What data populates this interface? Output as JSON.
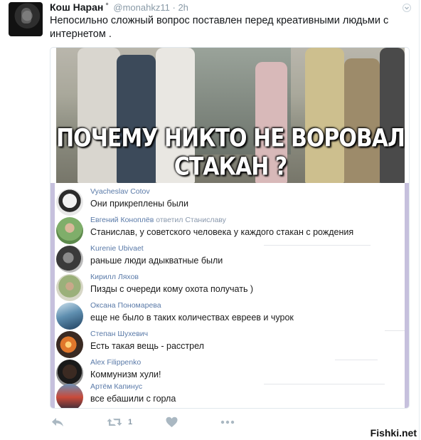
{
  "tweet": {
    "author_name": "Кош Наран",
    "verified_glyph": "°",
    "handle": "@monahkz11",
    "separator": "·",
    "time": "2h",
    "text": "Непосильно сложный вопрос поставлен перед креативными людьми с интернетом .",
    "retweet_count": "1"
  },
  "image": {
    "caption_line1": "ПОЧЕМУ НИКТО НЕ ВОРОВАЛ",
    "caption_line2": "СТАКАН ?"
  },
  "comments": [
    {
      "author": "Vyacheslav Cotov",
      "reply_label": "",
      "reply_to": "",
      "text": "Они прикреплены были"
    },
    {
      "author": "Евгений Коноплёв",
      "reply_label": "ответил",
      "reply_to": "Станиславу",
      "text": "Станислав, у советского человека у каждого стакан с рождения"
    },
    {
      "author": "Kurenie Ubivaet",
      "reply_label": "",
      "reply_to": "",
      "text": "раньше люди адыкватные были"
    },
    {
      "author": "Кирилл Ляхов",
      "reply_label": "",
      "reply_to": "",
      "text": "Пизды с очереди кому охота получать )"
    },
    {
      "author": "Оксана Пономарева",
      "reply_label": "",
      "reply_to": "",
      "text": "еще не было в таких количествах евреев и чурок"
    },
    {
      "author": "Степан Шухевич",
      "reply_label": "",
      "reply_to": "",
      "text": "Есть такая вещь - расстрел"
    },
    {
      "author": "Alex Filippenko",
      "reply_label": "",
      "reply_to": "",
      "text": "Коммунизм хули!"
    },
    {
      "author": "Артём Капинус",
      "reply_label": "",
      "reply_to": "",
      "text": "все ебашили с горла"
    }
  ],
  "icons": {
    "reply": "reply-icon",
    "retweet": "retweet-icon",
    "like": "heart-icon",
    "more": "more-dots-icon",
    "caret": "chevron-down-icon"
  },
  "colors": {
    "comment_author": "#5a7aa8",
    "muted": "#8899a6",
    "side_bar": "#c6c0dd"
  },
  "watermark": "Fishki.net"
}
